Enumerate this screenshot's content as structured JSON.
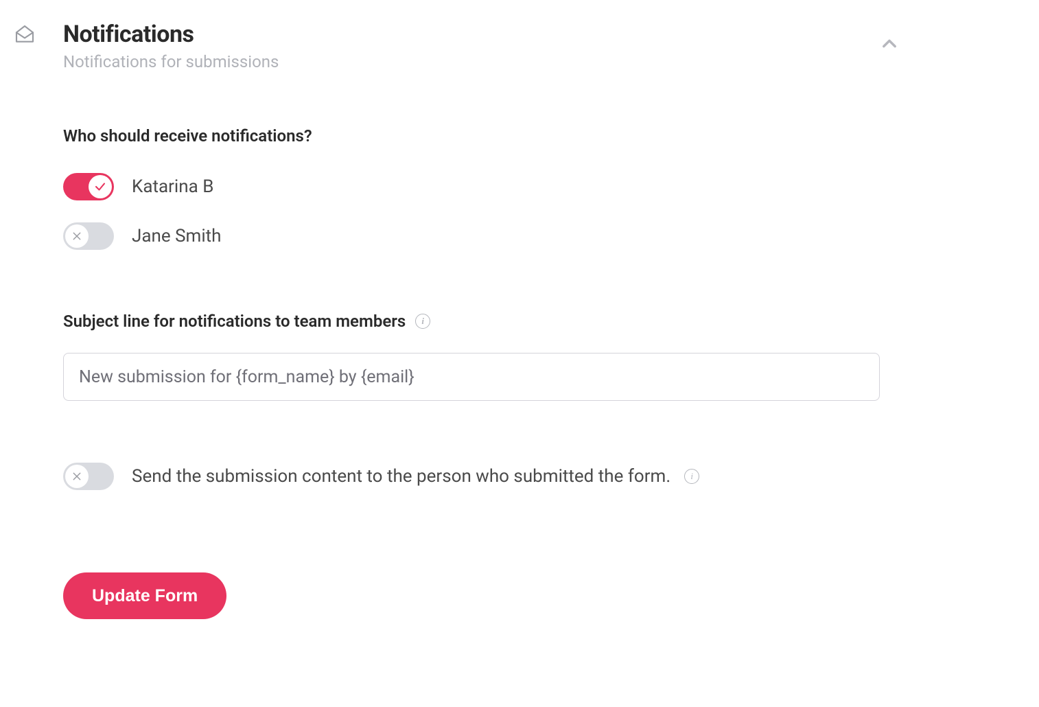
{
  "header": {
    "title": "Notifications",
    "subtitle": "Notifications for submissions"
  },
  "recipients": {
    "label": "Who should receive notifications?",
    "people": [
      {
        "name": "Katarina B",
        "enabled": true
      },
      {
        "name": "Jane Smith",
        "enabled": false
      }
    ]
  },
  "subject": {
    "label": "Subject line for notifications to team members",
    "value": "New submission for {form_name} by {email}"
  },
  "send_submission": {
    "label": "Send the submission content to the person who submitted the form.",
    "enabled": false
  },
  "actions": {
    "update_label": "Update Form"
  },
  "colors": {
    "accent": "#e8355f"
  }
}
